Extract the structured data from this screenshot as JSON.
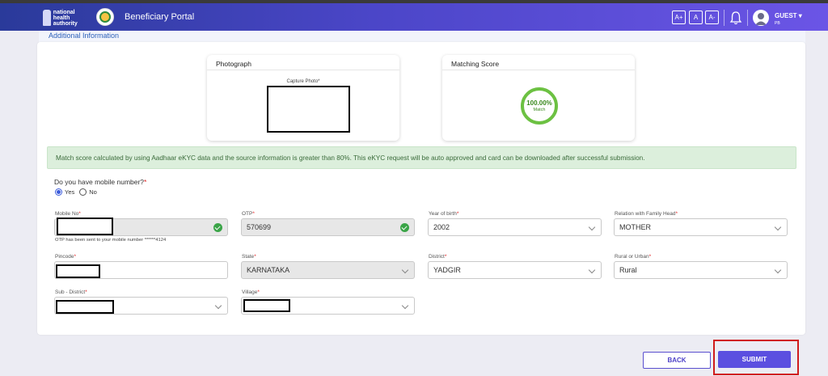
{
  "header": {
    "logo_lines": [
      "national",
      "health",
      "authority"
    ],
    "portal_title": "Beneficiary Portal",
    "font_buttons": [
      "A+",
      "A",
      "A-"
    ],
    "user_name": "GUEST",
    "user_sub": "PB"
  },
  "section": {
    "title": "Additional Information"
  },
  "photo_panel": {
    "title": "Photograph",
    "capture_label": "Capture Photo*"
  },
  "score_panel": {
    "title": "Matching Score",
    "value": "100.00%",
    "sub": "Match"
  },
  "alert": {
    "text": "Match score calculated by using Aadhaar eKYC data and the source information is greater than 80%. This eKYC request will be auto approved and card can be downloaded after successful submission."
  },
  "mobile_question": {
    "label": "Do you have mobile number?",
    "options": [
      "Yes",
      "No"
    ],
    "selected": "Yes"
  },
  "fields": {
    "mobile": {
      "label": "Mobile No",
      "value": ""
    },
    "otp": {
      "label": "OTP",
      "value": "570699"
    },
    "otp_hint": "OTP has been sent to your mobile number ******4124",
    "year_of_birth": {
      "label": "Year of birth",
      "value": "2002"
    },
    "relation": {
      "label": "Relation with Family Head",
      "value": "MOTHER"
    },
    "pincode": {
      "label": "Pincode",
      "value": ""
    },
    "state": {
      "label": "State",
      "value": "KARNATAKA"
    },
    "district": {
      "label": "District",
      "value": "YADGIR"
    },
    "rural_urban": {
      "label": "Rural or Urban",
      "value": "Rural"
    },
    "sub_district": {
      "label": "Sub - District",
      "value": ""
    },
    "village": {
      "label": "Village",
      "value": ""
    }
  },
  "buttons": {
    "back": "BACK",
    "submit": "SUBMIT"
  },
  "colors": {
    "header_start": "#2a3a9a",
    "header_end": "#6b55e6",
    "primary": "#5b4fe0",
    "success": "#6cc142",
    "alert_bg": "#dcefdc",
    "highlight": "#d01b1b"
  },
  "icons": [
    "nha-logo-icon",
    "state-emblem-icon",
    "bell-icon",
    "user-avatar-icon",
    "chevron-down-icon",
    "check-circle-icon"
  ]
}
